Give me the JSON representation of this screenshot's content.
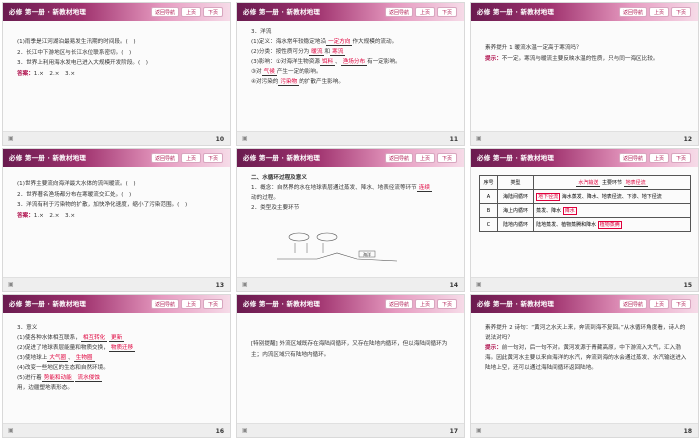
{
  "header": {
    "title": "必修 第一册 · 新教材地理",
    "nav_return": "返回导航",
    "nav_up": "上页",
    "nav_down": "下页"
  },
  "footer_icon": "ppt-icon",
  "slides": [
    {
      "page": "10",
      "lines": [
        "(1)雨季是江河湖泊最易发生汛期的时间段。(　)",
        "2．长江中下游地区与长江水位联系密切。(　)",
        "3．世界上利用海水发电已进入大规模开发阶段。(　)"
      ],
      "answer_label": "答案：",
      "answer": "1.×　2.×　3.×"
    },
    {
      "page": "11",
      "lines": [
        "3．洋流",
        "(1)定义：海水常年较稳定地沿",
        "(2)分类：按性质可分为",
        "(3)影响：①对海洋生物资源",
        "②对海洋渔业资源分布有一定影响。",
        "③对",
        "④对污染的"
      ],
      "blanks": [
        "一定方向",
        "暖流",
        "寒流",
        "饵料",
        "渔场分布",
        "气候",
        "污染物"
      ],
      "tails": [
        "作大规模的流动。",
        "",
        "有一定影响。",
        "产生一定的影响。",
        "的扩散产生影响。"
      ]
    },
    {
      "page": "12",
      "title": "素养提升 1 暖流水温一定高于寒流吗？",
      "tip_label": "提示：",
      "tip": "不一定。寒流与暖流主要反映水温的性质，只与同一海区比较。"
    },
    {
      "page": "13",
      "lines": [
        "(1)世界主要流向海洋最大水体的流叫暖流。(　)",
        "2．世界著名渔场都分布在寒暖流交汇处。(　)",
        "3．洋流有利于污染物的扩散，加快净化速度，缩小了污染范围。(　)"
      ],
      "answer_label": "答案：",
      "answer": "1.×　2.×　3.×"
    },
    {
      "page": "14",
      "lines": [
        "二、水循环过程及意义",
        "1．概念：自然界的水在地球表层通过蒸发、降水、地表径流等环节",
        "动的过程。",
        "2．类型及主要环节"
      ],
      "blank": "连续",
      "diagram_label": "海洋"
    },
    {
      "page": "15",
      "table_headers": [
        "序号",
        "类型",
        "主要环节"
      ],
      "table_top": [
        "水汽输送",
        "地表径流"
      ],
      "rows": [
        {
          "id": "A",
          "type": "海陆间循环",
          "detail": "海水蒸发、降水、地表径流、下渗、地下径流"
        },
        {
          "id": "B",
          "type": "海上内循环",
          "detail": "蒸发、降水"
        },
        {
          "id": "C",
          "type": "陆地内循环",
          "detail": "陆地蒸发、植物蒸腾和降水"
        }
      ],
      "marks": [
        "地下径流",
        "降水",
        "植物蒸腾"
      ]
    },
    {
      "page": "16",
      "lines": [
        "3．意义",
        "(1)使各种水体相互联系，",
        "(2)促进了地球表层能量和物质交换，",
        "(3)使地球上",
        "(4)改变一些地区的生态和自然环境。",
        "(5)进行着",
        "用，边疆塑地表形态。"
      ],
      "blanks": [
        "相互转化",
        "更新",
        "物质迁移",
        "大气圈",
        "生物圈",
        "势能和动能",
        "流水侵蚀"
      ]
    },
    {
      "page": "17",
      "text": "[特别提醒] 外流区域既存在海陆间循环，又存在陆地内循环，但以海陆间循环为主；内流区域只有陆地内循环。"
    },
    {
      "page": "18",
      "title": "素养提升 2 诗句：“黄河之水天上来，奔流到海不复回。”从水循环角度看，诗人的说法对吗？",
      "tip_label": "提示：",
      "tip": "前一句对，后一句不对。黄河发源于青藏高原，中下游流入大气，汇入渤海。因此黄河水主要以来自海洋的水汽，奔流到海的水会通过蒸发、水汽输送进入陆地上空，还可以通过海陆间循环返回陆地。"
    }
  ]
}
